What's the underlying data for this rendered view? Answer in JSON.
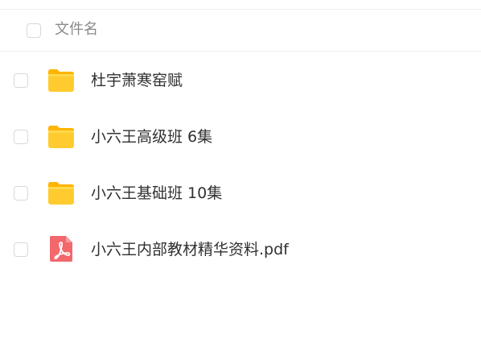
{
  "header": {
    "column_label": "文件名"
  },
  "files": [
    {
      "name": "杜宇萧寒窑赋",
      "type": "folder",
      "icon": "folder-icon"
    },
    {
      "name": "小六王高级班 6集",
      "type": "folder",
      "icon": "folder-icon"
    },
    {
      "name": "小六王基础班 10集",
      "type": "folder",
      "icon": "folder-icon"
    },
    {
      "name": "小六王内部教材精华资料.pdf",
      "type": "pdf",
      "icon": "pdf-icon"
    }
  ],
  "colors": {
    "folder_body": "#FFCB2E",
    "folder_tab": "#FFB400",
    "pdf_body": "#F2686D",
    "text": "#303030",
    "header_text": "#8A8A8A",
    "border": "#EEEEEE"
  }
}
